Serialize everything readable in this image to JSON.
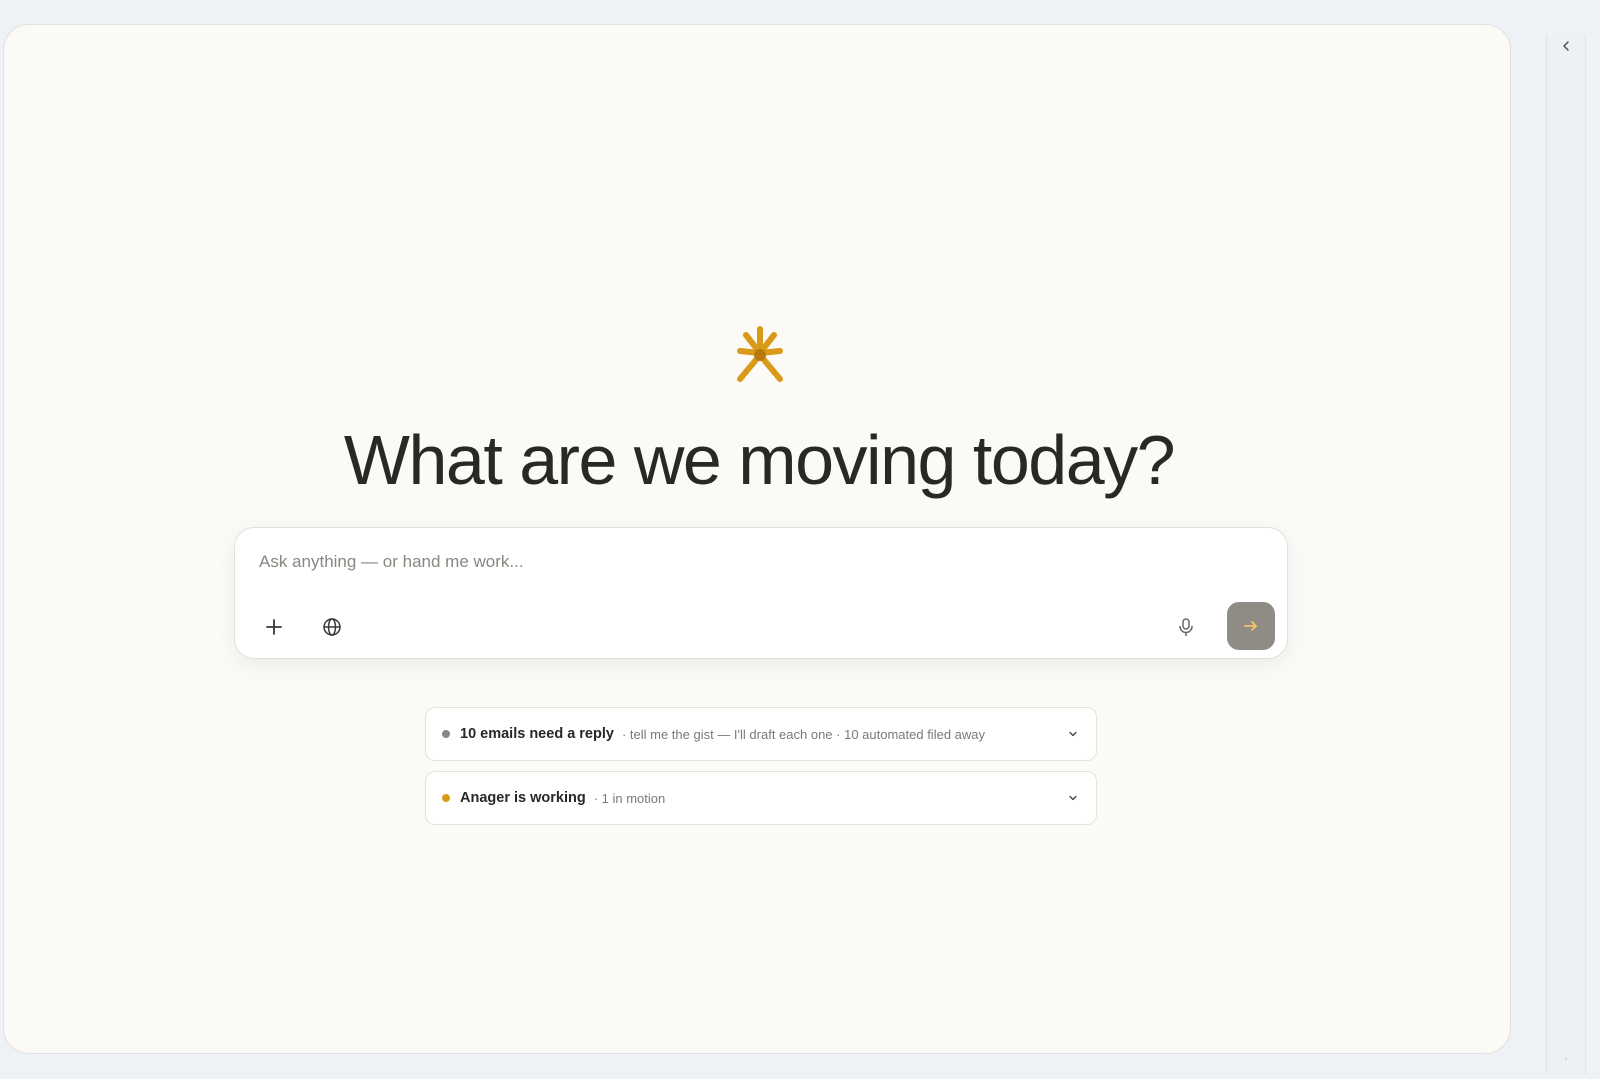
{
  "hero": {
    "headline": "What are we moving today?"
  },
  "composer": {
    "placeholder": "Ask anything — or hand me work..."
  },
  "status_rows": [
    {
      "title": "10 emails need a reply",
      "subtitle": "· tell me the gist — I'll draft each one · 10 automated filed away",
      "dot_color": "#8a8680"
    },
    {
      "title": "Anager is working",
      "subtitle": "· 1 in motion",
      "dot_color": "#d99a1a"
    }
  ],
  "colors": {
    "accent": "#d99a1a",
    "send_button": "#8f8c86",
    "send_arrow": "#f2c46a"
  },
  "icons": {
    "logo": "asterisk-person-logo",
    "collapse": "chevron-left-icon",
    "add": "plus-icon",
    "web": "globe-icon",
    "voice": "microphone-icon",
    "send": "arrow-right-icon",
    "expand": "chevron-down-icon"
  }
}
